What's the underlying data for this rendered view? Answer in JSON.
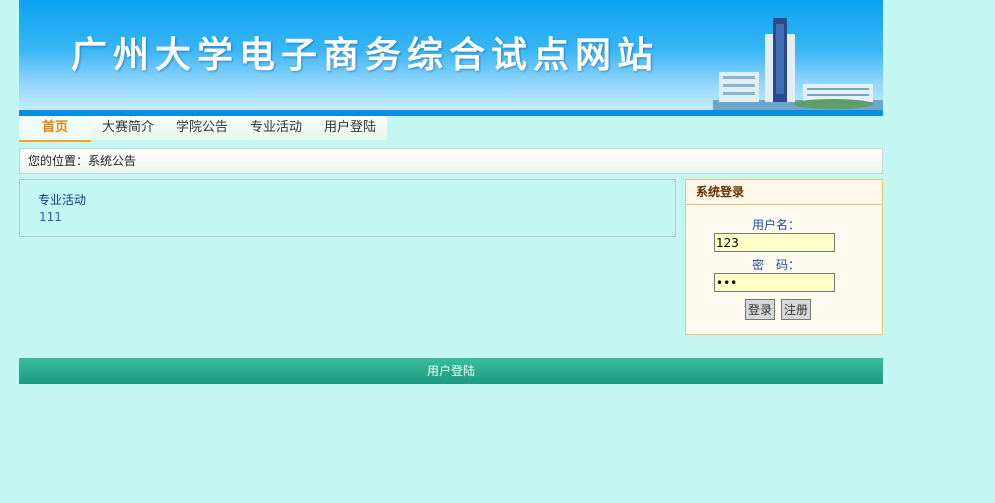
{
  "banner": {
    "title": "广州大学电子商务综合试点网站"
  },
  "nav": {
    "items": [
      {
        "label": "首页"
      },
      {
        "label": "大赛简介"
      },
      {
        "label": "学院公告"
      },
      {
        "label": "专业活动"
      },
      {
        "label": "用户登陆"
      }
    ]
  },
  "breadcrumb": {
    "text": "您的位置：系统公告"
  },
  "main": {
    "link": "专业活动",
    "sub_item": "111"
  },
  "login": {
    "header": "系统登录",
    "username_label": "用户名：",
    "username_value": "123",
    "password_label": "密　码：",
    "password_value": "123",
    "login_button": "登录",
    "register_button": "注册"
  },
  "footer": {
    "label": "用户登陆"
  },
  "colors": {
    "page_bg": "#c4f7f2",
    "banner_blue": "#0aa2f1",
    "nav_active": "#e8820a",
    "footer_green": "#1d9a82",
    "login_border": "#f0c070"
  }
}
